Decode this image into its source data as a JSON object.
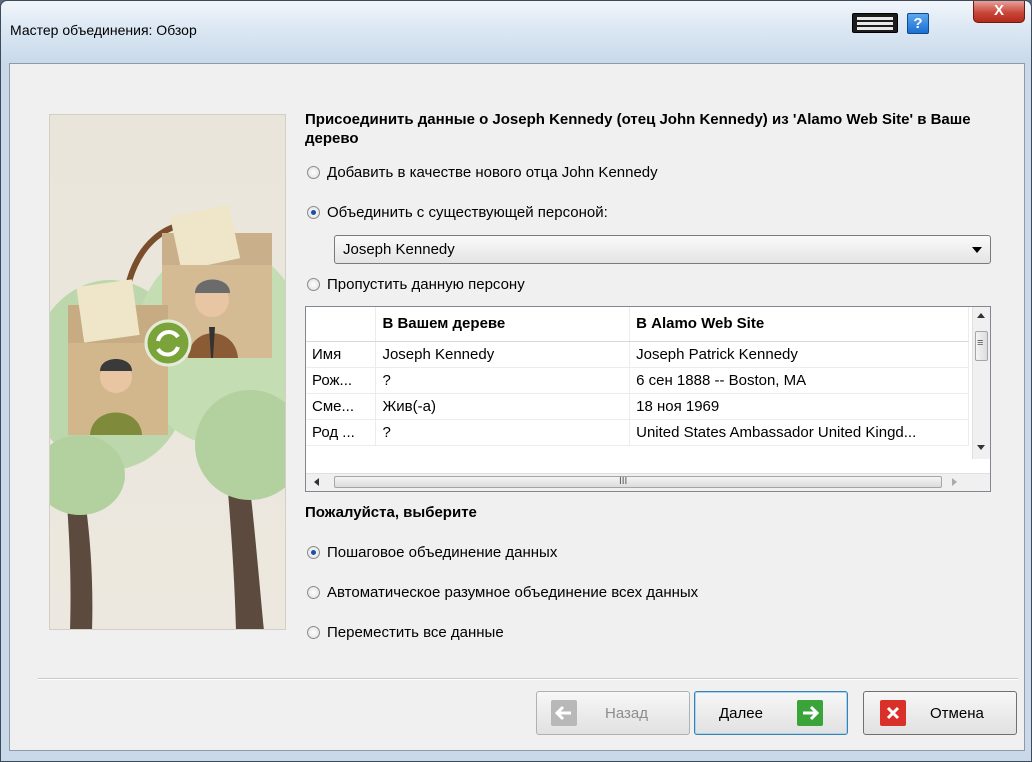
{
  "window": {
    "title": "Мастер объединения: Обзор",
    "close_glyph": "X",
    "help_glyph": "?"
  },
  "heading": "Присоединить данные о Joseph Kennedy (отец John Kennedy) из 'Alamo Web Site' в Ваше дерево",
  "merge_options": [
    {
      "label": "Добавить в качестве нового отца John Kennedy",
      "selected": false
    },
    {
      "label": "Объединить с существующей персоной:",
      "selected": true
    },
    {
      "label": "Пропустить данную персону",
      "selected": false
    }
  ],
  "person_select": {
    "value": "Joseph Kennedy"
  },
  "grid": {
    "columns": [
      "",
      "В Вашем дереве",
      "В Alamo Web Site"
    ],
    "rows": [
      [
        "Имя",
        "Joseph Kennedy",
        "Joseph Patrick Kennedy"
      ],
      [
        "Рож...",
        "?",
        "6 сен 1888 -- Boston, MA"
      ],
      [
        "Сме...",
        "Жив(-а)",
        "18 ноя 1969"
      ],
      [
        "Род ...",
        "?",
        "United States Ambassador United Kingd..."
      ]
    ],
    "hscroll_glyph": "III",
    "vscroll_glyph": "≡"
  },
  "choose_heading": "Пожалуйста, выберите",
  "method_options": [
    {
      "label": "Пошаговое объединение данных",
      "selected": true
    },
    {
      "label": "Автоматическое разумное объединение всех данных",
      "selected": false
    },
    {
      "label": "Переместить все данные",
      "selected": false
    }
  ],
  "buttons": {
    "back": "Назад",
    "next": "Далее",
    "cancel": "Отмена"
  },
  "colors": {
    "next_icon": "#3aa33a",
    "cancel_icon": "#d9312a",
    "back_icon": "#b8b8b8"
  }
}
